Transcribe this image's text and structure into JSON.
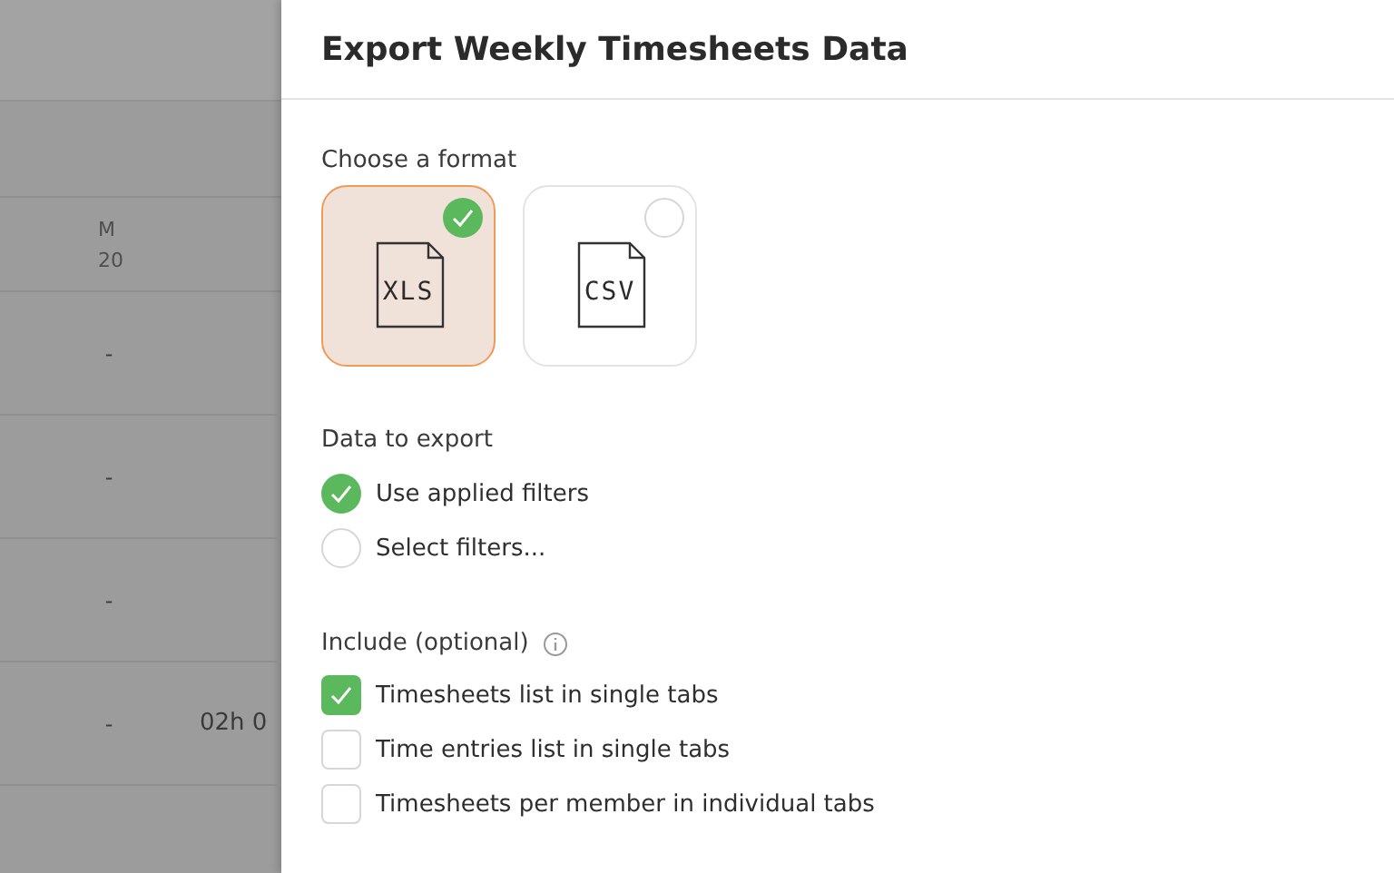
{
  "background_table": {
    "header": {
      "day": "M",
      "date": "20"
    },
    "rows": [
      {
        "column_1": "-"
      },
      {
        "column_1": "-"
      },
      {
        "column_1": "-"
      },
      {
        "column_1": "-",
        "column_2": "02h 0"
      }
    ]
  },
  "panel": {
    "title": "Export Weekly Timesheets Data",
    "format": {
      "label": "Choose a format",
      "options": [
        {
          "label": "XLS",
          "selected": true
        },
        {
          "label": "CSV",
          "selected": false
        }
      ]
    },
    "data_to_export": {
      "label": "Data to export",
      "options": [
        {
          "label": "Use applied filters",
          "selected": true
        },
        {
          "label": "Select filters...",
          "selected": false
        }
      ]
    },
    "include": {
      "label": "Include (optional)",
      "items": [
        {
          "label": "Timesheets list in single tabs",
          "checked": true
        },
        {
          "label": "Time entries list in single tabs",
          "checked": false
        },
        {
          "label": "Timesheets per member in individual tabs",
          "checked": false
        }
      ]
    }
  }
}
